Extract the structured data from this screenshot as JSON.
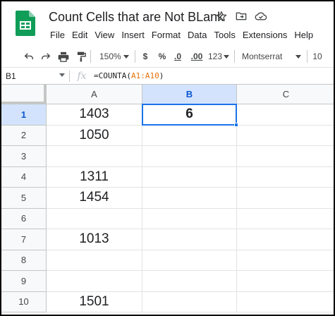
{
  "document": {
    "title": "Count Cells that are Not BLank"
  },
  "menus": [
    "File",
    "Edit",
    "View",
    "Insert",
    "Format",
    "Data",
    "Tools",
    "Extensions",
    "Help"
  ],
  "toolbar": {
    "zoom": "150%",
    "currency": "$",
    "percent": "%",
    "decrease_decimal": ".0",
    "increase_decimal": ".00",
    "more_formats": "123",
    "font": "Montserrat",
    "font_size": "10"
  },
  "formula_bar": {
    "cell_ref": "B1",
    "formula_prefix": "=COUNTA(",
    "formula_range": "A1:A10",
    "formula_suffix": ")"
  },
  "columns": [
    "A",
    "B",
    "C"
  ],
  "rows": [
    {
      "num": "1",
      "a": "1403",
      "b": "6"
    },
    {
      "num": "2",
      "a": "1050",
      "b": ""
    },
    {
      "num": "3",
      "a": "",
      "b": ""
    },
    {
      "num": "4",
      "a": "1311",
      "b": ""
    },
    {
      "num": "5",
      "a": "1454",
      "b": ""
    },
    {
      "num": "6",
      "a": "",
      "b": ""
    },
    {
      "num": "7",
      "a": "1013",
      "b": ""
    },
    {
      "num": "8",
      "a": "",
      "b": ""
    },
    {
      "num": "9",
      "a": "",
      "b": ""
    },
    {
      "num": "10",
      "a": "1501",
      "b": ""
    }
  ],
  "colors": {
    "accent": "#1a73e8",
    "sheets_green": "#0f9d58"
  }
}
